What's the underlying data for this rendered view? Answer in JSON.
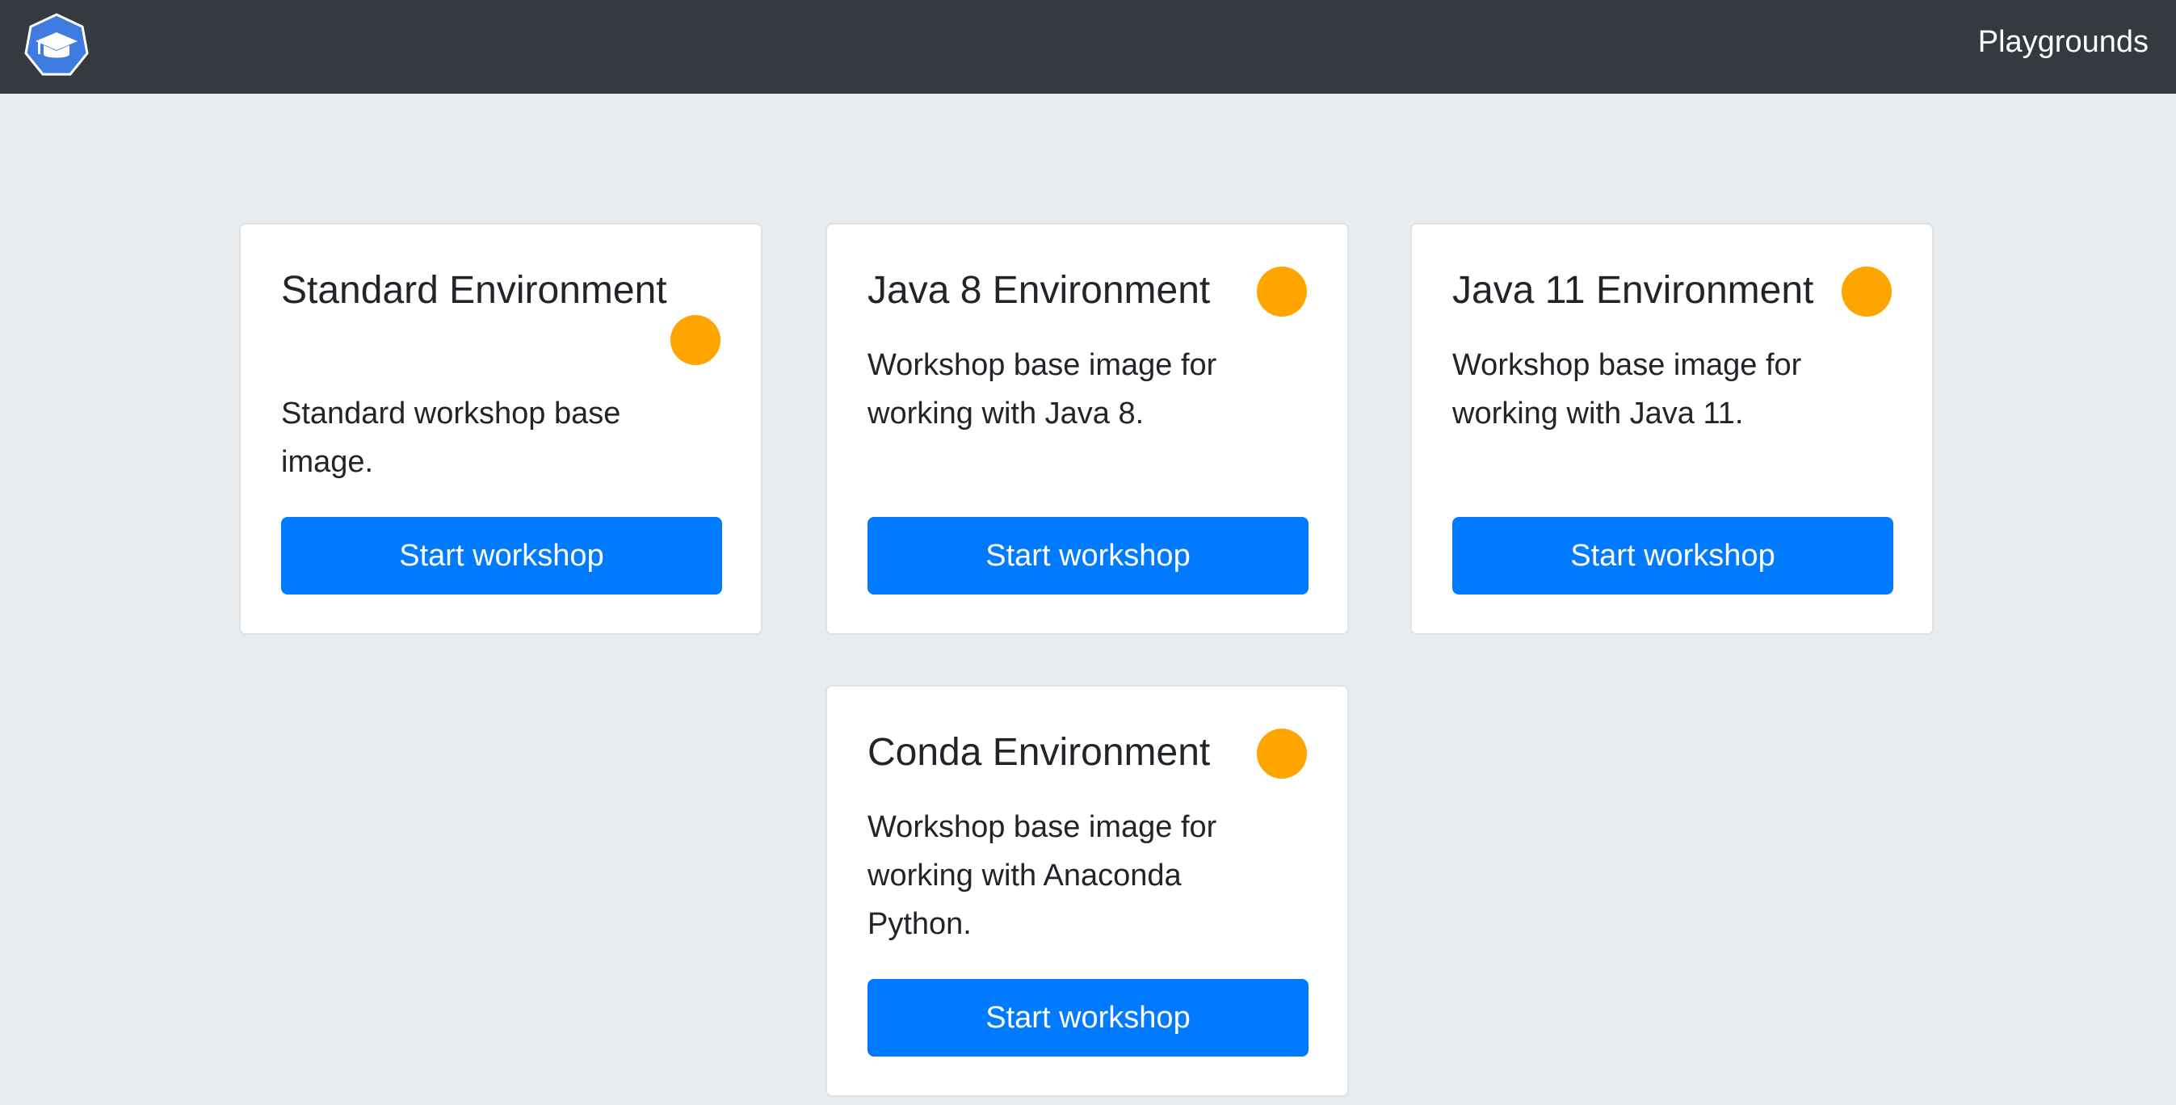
{
  "navbar": {
    "logo_icon": "graduation-cap-icon",
    "link_label": "Playgrounds",
    "background": "#343a40"
  },
  "colors": {
    "page_background": "#e9ecef",
    "button": "#007bff",
    "status_dot": "#ffa500"
  },
  "environments": [
    {
      "title": "Standard Environment",
      "description": "Standard workshop base image.",
      "button_label": "Start workshop"
    },
    {
      "title": "Java 8 Environment",
      "description": "Workshop base image for working with Java 8.",
      "button_label": "Start workshop"
    },
    {
      "title": "Java 11 Environment",
      "description": "Workshop base image for working with Java 11.",
      "button_label": "Start workshop"
    },
    {
      "title": "Conda Environment",
      "description": "Workshop base image for working with Anaconda Python.",
      "button_label": "Start workshop"
    }
  ]
}
